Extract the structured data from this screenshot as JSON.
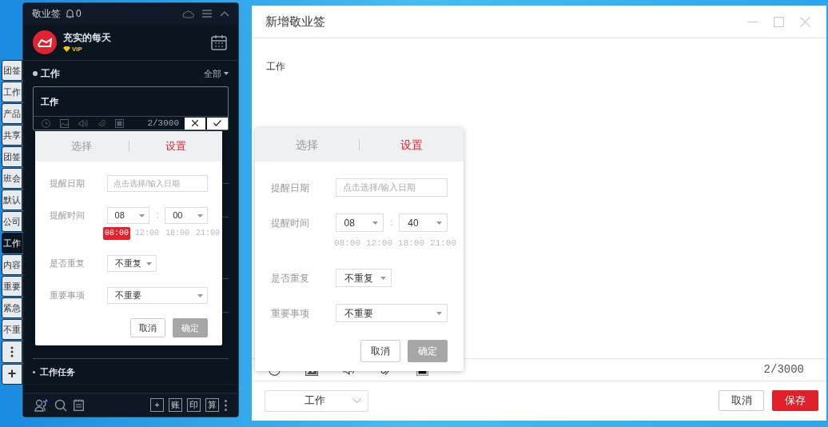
{
  "side_tabs": [
    {
      "label": "团签",
      "selected": false
    },
    {
      "label": "工作",
      "selected": false
    },
    {
      "label": "产品",
      "selected": false
    },
    {
      "label": "共享",
      "selected": false
    },
    {
      "label": "团签",
      "selected": false
    },
    {
      "label": "班会",
      "selected": false
    },
    {
      "label": "默认",
      "selected": false
    },
    {
      "label": "公司",
      "selected": false
    },
    {
      "label": "工作",
      "selected": true
    },
    {
      "label": "内容",
      "selected": false
    },
    {
      "label": "重要",
      "selected": false
    },
    {
      "label": "紧急",
      "selected": false
    },
    {
      "label": "不重",
      "selected": false
    }
  ],
  "side_tab_add": "+",
  "note_panel": {
    "app_title": "敬业签",
    "notification_count": "0",
    "user_name": "充实的每天",
    "vip_label": "VIP",
    "category": "工作",
    "filter": "全部",
    "note_text": "工作",
    "char_count": "2/3000",
    "section_title": "工作任务",
    "toolbar_buttons": [
      "+",
      "账",
      "印",
      "算"
    ]
  },
  "panel_popup": {
    "tabs": [
      {
        "label": "选择",
        "selected": false
      },
      {
        "label": "设置",
        "selected": true
      }
    ],
    "date_label": "提醒日期",
    "date_placeholder": "点击选择/输入日期",
    "time_label": "提醒时间",
    "hour": "08",
    "minute": "00",
    "quick_times": [
      {
        "label": "08:00",
        "selected": true
      },
      {
        "label": "12:00",
        "selected": false
      },
      {
        "label": "18:00",
        "selected": false
      },
      {
        "label": "21:00",
        "selected": false
      }
    ],
    "repeat_label": "是否重复",
    "repeat_value": "不重复",
    "importance_label": "重要事项",
    "importance_value": "不重要",
    "cancel": "取消",
    "confirm": "确定",
    "confirm_disabled": true
  },
  "editor_window": {
    "title": "新增敬业签",
    "content": "工作",
    "char_count": "2/3000",
    "category": "工作",
    "cancel": "取消",
    "save": "保存"
  },
  "editor_popup": {
    "tabs": [
      {
        "label": "选择",
        "selected": false
      },
      {
        "label": "设置",
        "selected": true
      }
    ],
    "date_label": "提醒日期",
    "date_placeholder": "点击选择/输入日期",
    "time_label": "提醒时间",
    "hour": "08",
    "minute": "40",
    "quick_times": [
      {
        "label": "08:00",
        "selected": false
      },
      {
        "label": "12:00",
        "selected": false
      },
      {
        "label": "18:00",
        "selected": false
      },
      {
        "label": "21:00",
        "selected": false
      }
    ],
    "repeat_label": "是否重复",
    "repeat_value": "不重复",
    "importance_label": "重要事项",
    "importance_value": "不重要",
    "cancel": "取消",
    "confirm": "确定",
    "confirm_disabled": true
  }
}
